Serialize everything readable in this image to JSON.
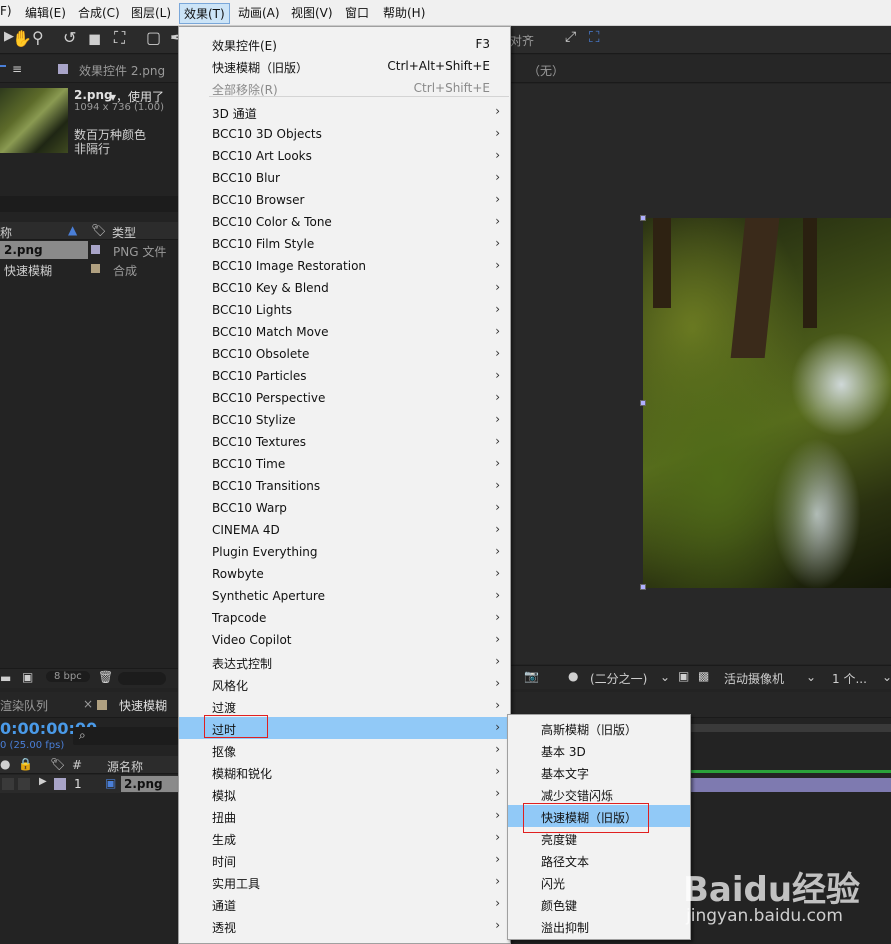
{
  "menubar": {
    "items": [
      "F)",
      "编辑(E)",
      "合成(C)",
      "图层(L)",
      "效果(T)",
      "动画(A)",
      "视图(V)",
      "窗口",
      "帮助(H)"
    ]
  },
  "toolbar": {
    "align_label": "对齐"
  },
  "project": {
    "tab_menu_icon": "≡",
    "effect_controls_tab": "效果控件 2.png",
    "file_name": "2.png",
    "file_used": "▾，使用了",
    "file_dims": "1094 x 736 (1.00)",
    "file_desc1": "数百万种颜色",
    "file_desc2": "非隔行",
    "col_name": "称",
    "col_type": "类型",
    "items": [
      {
        "name": "2.png",
        "type": "PNG 文件"
      },
      {
        "name": "快速模糊",
        "type": "合成"
      }
    ],
    "bpc": "8 bpc"
  },
  "viewer": {
    "tab_none": "（无）",
    "zoom_select": "(二分之一)",
    "camera_select": "活动摄像机",
    "views_select": "1 个..."
  },
  "timeline": {
    "render_queue_tab": "渲染队列",
    "comp_tab": "快速模糊",
    "timecode": "0:00:00:00",
    "fps": "0 (25.00 fps)",
    "search_icon": "⌕",
    "col_hash": "#",
    "col_source": "源名称",
    "layer_num": "1",
    "layer_name": "2.png"
  },
  "effects_menu": {
    "items": [
      {
        "label": "效果控件(E)",
        "shortcut": "F3"
      },
      {
        "label": "快速模糊（旧版）",
        "shortcut": "Ctrl+Alt+Shift+E"
      },
      {
        "label": "全部移除(R)",
        "shortcut": "Ctrl+Shift+E"
      },
      {
        "label": "3D 通道"
      },
      {
        "label": "BCC10 3D Objects"
      },
      {
        "label": "BCC10 Art Looks"
      },
      {
        "label": "BCC10 Blur"
      },
      {
        "label": "BCC10 Browser"
      },
      {
        "label": "BCC10 Color & Tone"
      },
      {
        "label": "BCC10 Film Style"
      },
      {
        "label": "BCC10 Image Restoration"
      },
      {
        "label": "BCC10 Key & Blend"
      },
      {
        "label": "BCC10 Lights"
      },
      {
        "label": "BCC10 Match Move"
      },
      {
        "label": "BCC10 Obsolete"
      },
      {
        "label": "BCC10 Particles"
      },
      {
        "label": "BCC10 Perspective"
      },
      {
        "label": "BCC10 Stylize"
      },
      {
        "label": "BCC10 Textures"
      },
      {
        "label": "BCC10 Time"
      },
      {
        "label": "BCC10 Transitions"
      },
      {
        "label": "BCC10 Warp"
      },
      {
        "label": "CINEMA 4D"
      },
      {
        "label": "Plugin Everything"
      },
      {
        "label": "Rowbyte"
      },
      {
        "label": "Synthetic Aperture"
      },
      {
        "label": "Trapcode"
      },
      {
        "label": "Video Copilot"
      },
      {
        "label": "表达式控制"
      },
      {
        "label": "风格化"
      },
      {
        "label": "过渡"
      },
      {
        "label": "过时"
      },
      {
        "label": "抠像"
      },
      {
        "label": "模糊和锐化"
      },
      {
        "label": "模拟"
      },
      {
        "label": "扭曲"
      },
      {
        "label": "生成"
      },
      {
        "label": "时间"
      },
      {
        "label": "实用工具"
      },
      {
        "label": "通道"
      },
      {
        "label": "透视"
      }
    ],
    "arrow": "›"
  },
  "obsolete_submenu": {
    "items": [
      "高斯模糊（旧版）",
      "基本 3D",
      "基本文字",
      "减少交错闪烁",
      "快速模糊（旧版）",
      "亮度键",
      "路径文本",
      "闪光",
      "颜色键",
      "溢出抑制"
    ]
  },
  "watermark": {
    "logo": "Baidu经验",
    "url": "jingyan.baidu.com"
  },
  "colors": {
    "menu_bg": "#f2f2f2",
    "highlight": "#91c9f7",
    "red_outline": "#e02020",
    "panel_bg": "#232323"
  }
}
